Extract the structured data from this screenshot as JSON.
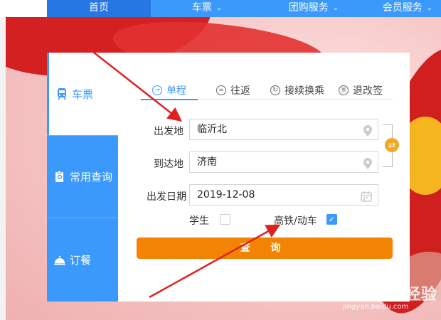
{
  "nav": {
    "items": [
      {
        "label": "首页",
        "has_dropdown": false,
        "active": true
      },
      {
        "label": "车票",
        "has_dropdown": true,
        "active": false
      },
      {
        "label": "团购服务",
        "has_dropdown": true,
        "active": false
      },
      {
        "label": "会员服务",
        "has_dropdown": true,
        "active": false
      }
    ],
    "chevron_glyph": "⌄"
  },
  "sidebar": {
    "items": [
      {
        "label": "车票",
        "icon": "train-icon",
        "active": true
      },
      {
        "label": "常用查询",
        "icon": "clipboard-search-icon",
        "active": false
      },
      {
        "label": "订餐",
        "icon": "food-cloche-icon",
        "active": false
      }
    ]
  },
  "trip_tabs": [
    {
      "label": "单程",
      "icon": "arrow-circle-icon",
      "glyph": "→",
      "active": true
    },
    {
      "label": "往返",
      "icon": "equals-circle-icon",
      "glyph": "=",
      "active": false
    },
    {
      "label": "接续换乘",
      "icon": "refresh-circle-icon",
      "glyph": "↻",
      "active": false
    },
    {
      "label": "退改签",
      "icon": "ticket-circle-icon",
      "glyph": "票",
      "active": false
    }
  ],
  "form": {
    "from_label": "出发地",
    "from_value": "临沂北",
    "to_label": "到达地",
    "to_value": "济南",
    "date_label": "出发日期",
    "date_value": "2019-12-08",
    "student_label": "学生",
    "student_checked": false,
    "highspeed_label": "高铁/动车",
    "highspeed_checked": true,
    "search_label": "查 询",
    "swap_glyph": "⇄",
    "check_glyph": "✓"
  },
  "colors": {
    "primary": "#3b99fc",
    "nav_active": "#2676e3",
    "search_button": "#f38302",
    "swap_button": "#f5a623",
    "annotation_arrow": "#e02020"
  },
  "watermark": {
    "logo": "Bai du 经验",
    "url": "jingyan.baidu.com"
  }
}
